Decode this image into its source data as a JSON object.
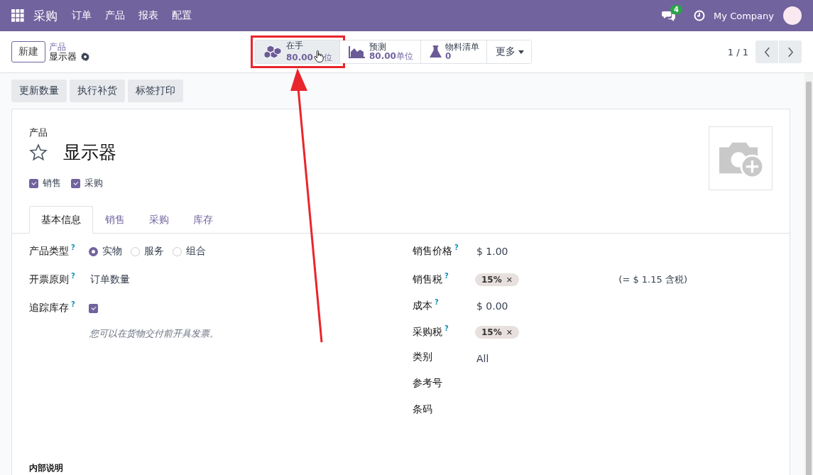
{
  "navbar": {
    "app": "采购",
    "menus": [
      "订单",
      "产品",
      "报表",
      "配置"
    ],
    "messages_badge": "4",
    "company": "My Company"
  },
  "control_panel": {
    "new_button": "新建",
    "breadcrumb": "产品",
    "record_title": "显示器",
    "smart_buttons": [
      {
        "kind": "on_hand",
        "label": "在手",
        "value": "80.00",
        "unit": "位",
        "highlighted": true,
        "pointer_over": true
      },
      {
        "kind": "forecast",
        "label": "预测",
        "value": "80.00",
        "unit": "单位",
        "highlighted": false
      },
      {
        "kind": "bom",
        "label": "物料清单",
        "value": "0",
        "highlighted": false
      }
    ],
    "more": "更多",
    "pager": "1 / 1"
  },
  "action_buttons": [
    "更新数量",
    "执行补货",
    "标签打印"
  ],
  "form": {
    "section_label": "产品",
    "name": "显示器",
    "favorite": false,
    "flags": [
      {
        "label": "销售",
        "checked": true
      },
      {
        "label": "采购",
        "checked": true
      }
    ],
    "tabs": [
      {
        "label": "基本信息",
        "selected": true
      },
      {
        "label": "销售",
        "selected": false
      },
      {
        "label": "采购",
        "selected": false
      },
      {
        "label": "库存",
        "selected": false
      }
    ],
    "left_fields": [
      {
        "kind": "radio",
        "label": "产品类型",
        "help": "?",
        "options": [
          {
            "label": "实物",
            "selected": true
          },
          {
            "label": "服务",
            "selected": false
          },
          {
            "label": "组合",
            "selected": false
          }
        ]
      },
      {
        "kind": "text",
        "label": "开票原则",
        "help": "?",
        "value": "订单数量"
      },
      {
        "kind": "checkbox",
        "label": "追踪库存",
        "help": "?",
        "checked": true
      }
    ],
    "note": "您可以在货物交付前开具发票。",
    "right_fields": [
      {
        "kind": "text",
        "label": "销售价格",
        "help": "?",
        "value": "$ 1.00"
      },
      {
        "kind": "tags",
        "label": "销售税",
        "help": "?",
        "tags": [
          {
            "label": "15%",
            "remove": "✕"
          }
        ],
        "extra": "(= $ 1.15 含税)"
      },
      {
        "kind": "text",
        "label": "成本",
        "help": "?",
        "value": "$ 0.00"
      },
      {
        "kind": "tags",
        "label": "采购税",
        "help": "?",
        "tags": [
          {
            "label": "15%",
            "remove": "✕"
          }
        ]
      },
      {
        "kind": "text",
        "label": "类别",
        "value": "All"
      },
      {
        "kind": "text",
        "label": "参考号"
      },
      {
        "kind": "text",
        "label": "条码"
      }
    ],
    "internal_notes_label": "内部说明"
  }
}
